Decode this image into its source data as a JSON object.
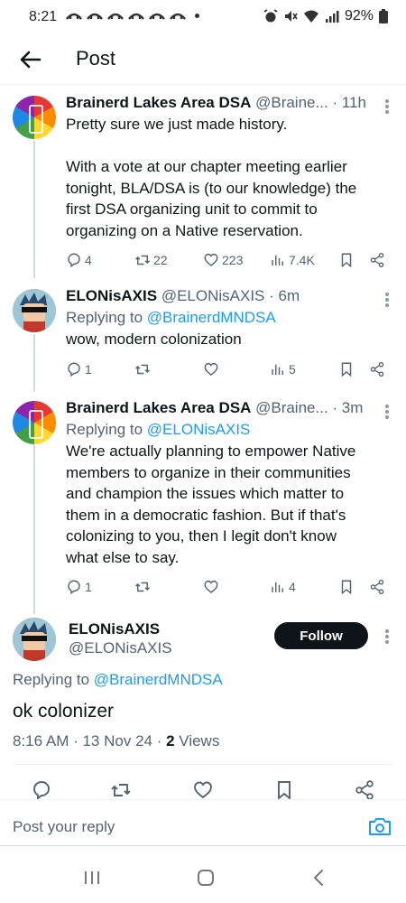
{
  "status_bar": {
    "time": "8:21",
    "battery": "92%"
  },
  "header": {
    "title": "Post"
  },
  "tweets": [
    {
      "name": "Brainerd Lakes Area DSA",
      "handle": "@Braine...",
      "time": "· 11h",
      "text": "Pretty sure we just made history.\n\nWith a vote at our chapter meeting earlier tonight, BLA/DSA is (to our knowledge) the first DSA organizing unit to commit to organizing on a Native reservation.",
      "replies": "4",
      "reposts": "22",
      "likes": "223",
      "views": "7.4K"
    },
    {
      "name": "ELONisAXIS",
      "handle": "@ELONisAXIS",
      "time": "· 6m",
      "replying_prefix": "Replying to",
      "replying_to": "@BrainerdMNDSA",
      "text": "wow, modern colonization",
      "replies": "1",
      "reposts": "",
      "likes": "",
      "views": "5"
    },
    {
      "name": "Brainerd Lakes Area DSA",
      "handle": "@Braine...",
      "time": "· 3m",
      "replying_prefix": "Replying to",
      "replying_to": "@ELONisAXIS",
      "text": "We're actually planning to empower Native members to organize in their communities and champion the issues which matter to them in a democratic fashion. But if that's colonizing to you, then I legit don't know what else to say.",
      "replies": "1",
      "reposts": "",
      "likes": "",
      "views": "4"
    }
  ],
  "main_tweet": {
    "name": "ELONisAXIS",
    "handle": "@ELONisAXIS",
    "follow_label": "Follow",
    "replying_prefix": "Replying to",
    "replying_to": "@BrainerdMNDSA",
    "text": "ok colonizer",
    "timestamp": "8:16 AM · 13 Nov 24 · ",
    "views_count": "2",
    "views_label": " Views"
  },
  "reply_bar": {
    "placeholder": "Post your reply"
  },
  "colors": {
    "accent": "#1d9bf0",
    "text": "#0f1419",
    "muted": "#536471"
  },
  "icons": [
    "back-arrow-icon",
    "reply-icon",
    "repost-icon",
    "like-icon",
    "views-icon",
    "bookmark-icon",
    "share-icon",
    "camera-icon",
    "more-icon"
  ]
}
